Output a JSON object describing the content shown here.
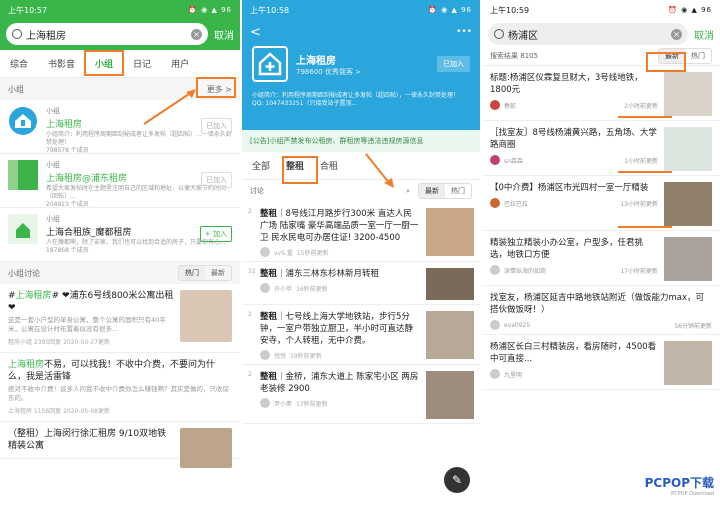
{
  "panel1": {
    "time": "上午10:57",
    "status_icons": "⏰ ◉ ▲ 96",
    "search_value": "上海租房",
    "cancel": "取消",
    "tabs": [
      "综合",
      "书影音",
      "小组",
      "日记",
      "用户"
    ],
    "groups_header": "小组",
    "more": "更多 >",
    "groups": [
      {
        "type": "小组",
        "name": "上海租房",
        "desc": "小组简介：利用程序周期距刮秘成者让多发帖（超四帖）...一律永久封禁处理！",
        "members": "798578 个成员",
        "button": "已加入"
      },
      {
        "type": "小组",
        "name": "上海租房@浦东租房",
        "desc": "希望大家发帖时在主题里注明自己的区域和地址，以便大家节约时间（回帖）...",
        "members": "204923 个成员",
        "button": "已加入"
      },
      {
        "type": "小组",
        "name": "上海合租族_魔都租房",
        "desc": "人在魔都啊，除了安家，我们也可以找到合适的房子，只要你有心...",
        "members": "187868 个成员",
        "button": "+ 加入"
      }
    ],
    "discuss_header": "小组讨论",
    "seg": [
      "热门",
      "最新"
    ],
    "posts": [
      {
        "title_pre": "#",
        "title_green": "上海租房",
        "title_post": "# ❤浦东6号线800米公寓出租 ❤",
        "snippet": "这是一套小户型的单身公寓，整个公寓的面积只有40平米，公寓在设计时布置着似没有很多...",
        "meta": "租房小组  2393回复  2020-03-27更新"
      },
      {
        "title_pre": "",
        "title_green": "上海租房",
        "title_post": "不易，可以找我！不收中介费，不要问为什么，我是活雷锋",
        "snippet": "绝对不收中介费！谈多人问我不收中介费你怎么赚钱啊？其实是做的，只收房东的。",
        "meta": "上海租房  1156回复  2020-05-08更新"
      },
      {
        "title_pre": "",
        "title_green": "",
        "title_post": "（整租）上海闵行徐汇租房 9/10双地铁 精装公寓",
        "snippet": "",
        "meta": ""
      }
    ]
  },
  "panel2": {
    "time": "上午10:58",
    "status_icons": "⏰ ◉ ▲ 96",
    "back": "<",
    "menu": "•••",
    "group_name": "上海租房",
    "group_members": "798600 优秀我客 >",
    "joined": "已加入",
    "intro": "小组简介：利用程序周期距刮秘成者让多发帖（超四帖），一律永久封禁处理！ QQ: 1047433251（只接受站子置顶...",
    "notice": "[公告]小组严禁发布公租房、群租房等违法违规房源信息",
    "tabs": [
      "全部",
      "整租",
      "合租"
    ],
    "discuss": "讨论",
    "seg": [
      "最新",
      "热门"
    ],
    "posts": [
      {
        "tag": "整租",
        "title": "｜8号线江月路步行300米 直达人民广场 陆家嘴 豪华高端品质一室一厅一厨一卫 民水民电可办居住证! 3200-4500",
        "user": "vvS.重",
        "time": "15秒前更新",
        "count": "2"
      },
      {
        "tag": "整租",
        "title": "｜浦东三林东杉林新月转租",
        "user": "许小苹",
        "time": "16秒前更新",
        "count": "32"
      },
      {
        "tag": "整租",
        "title": "｜七号线上海大学地铁站，步行5分钟，一室户带独立厨卫，半小时可直达静安寺，个人转租，无中介费。",
        "user": "悦悦",
        "time": "19秒前更新",
        "count": "2"
      },
      {
        "tag": "整租",
        "title": "｜金桥，浦东大道上 陈家宅小区 两房 老装修 2900",
        "user": "尹小素",
        "time": "17秒前更新",
        "count": "2"
      }
    ],
    "fab": "✎"
  },
  "panel3": {
    "time": "上午10:59",
    "status_icons": "⏰ ◉ ▲ 96",
    "search_value": "杨浦区",
    "cancel": "取消",
    "result_count": "搜索结果 8105",
    "sort": [
      "最新",
      "热门"
    ],
    "posts": [
      {
        "title": "标题:杨浦区仪霖复旦财大，3号线地铁，1800元",
        "user": "春蛇",
        "time": "2小时前更新"
      },
      {
        "title": "［找室友］8号线杨浦黄兴路，五角场、大学路商圈",
        "user": "sn森森",
        "time": "1小时前更新"
      },
      {
        "title": "【0中介费】杨浦区市光四村一室一厅精装",
        "user": "巴拉巴拉",
        "time": "13小时前更新"
      },
      {
        "title": "精装独立精装小办公室，户型多，任君挑选，地铁口方便",
        "user": "深情似海的如商",
        "time": "17小时前更新"
      },
      {
        "title": "找室友，杨浦区延吉中路地铁站附近（做饭能力max，可搭伙做饭呀！）",
        "user": "eva0925",
        "time": "56分钟前更新"
      },
      {
        "title": "杨浦区长白三村精装房，看房随时，4500看中可直接...",
        "user": "九里明",
        "time": ""
      }
    ],
    "watermark": "PCPOP下载",
    "watermark_sub": "PCPOP Download"
  }
}
